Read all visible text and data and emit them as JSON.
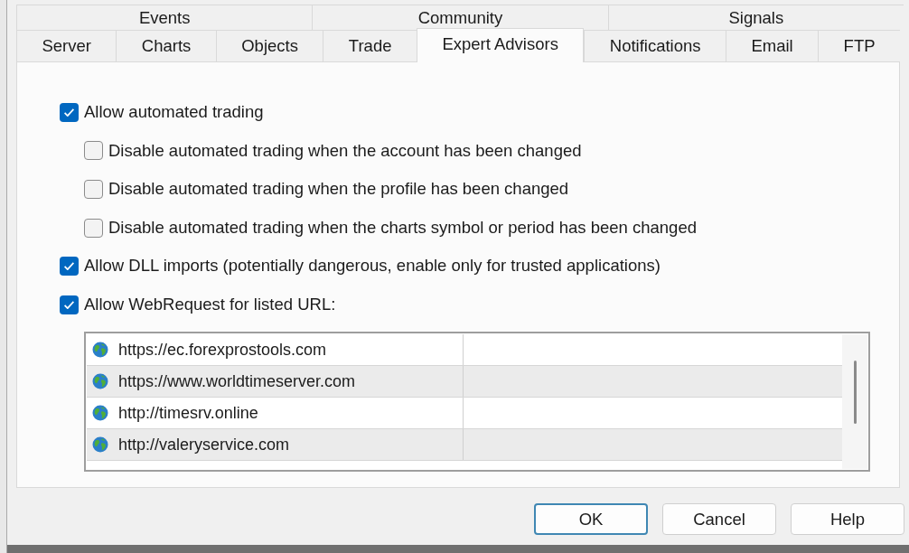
{
  "tab_rows": [
    {
      "tabs": [
        {
          "label": "Events",
          "selected": false
        },
        {
          "label": "Community",
          "selected": false
        },
        {
          "label": "Signals",
          "selected": false
        }
      ]
    },
    {
      "tabs": [
        {
          "label": "Server",
          "selected": false
        },
        {
          "label": "Charts",
          "selected": false
        },
        {
          "label": "Objects",
          "selected": false
        },
        {
          "label": "Trade",
          "selected": false
        },
        {
          "label": "Expert Advisors",
          "selected": true
        },
        {
          "label": "Notifications",
          "selected": false
        },
        {
          "label": "Email",
          "selected": false
        },
        {
          "label": "FTP",
          "selected": false
        }
      ]
    }
  ],
  "options": [
    {
      "label": "Allow automated trading",
      "checked": true,
      "children": [
        {
          "label": "Disable automated trading when the account has been changed",
          "checked": false
        },
        {
          "label": "Disable automated trading when the profile has been changed",
          "checked": false
        },
        {
          "label": "Disable automated trading when the charts symbol or period has been changed",
          "checked": false
        }
      ]
    },
    {
      "label": "Allow DLL imports (potentially dangerous, enable only for trusted applications)",
      "checked": true
    },
    {
      "label": "Allow WebRequest for listed URL:",
      "checked": true
    }
  ],
  "url_list": {
    "rows": [
      {
        "url": "https://ec.forexprostools.com"
      },
      {
        "url": "https://www.worldtimeserver.com"
      },
      {
        "url": "http://timesrv.online"
      },
      {
        "url": "http://valeryservice.com"
      }
    ]
  },
  "buttons": [
    {
      "label": "OK",
      "focused": true
    },
    {
      "label": "Cancel",
      "focused": false
    },
    {
      "label": "Help",
      "focused": false
    }
  ]
}
